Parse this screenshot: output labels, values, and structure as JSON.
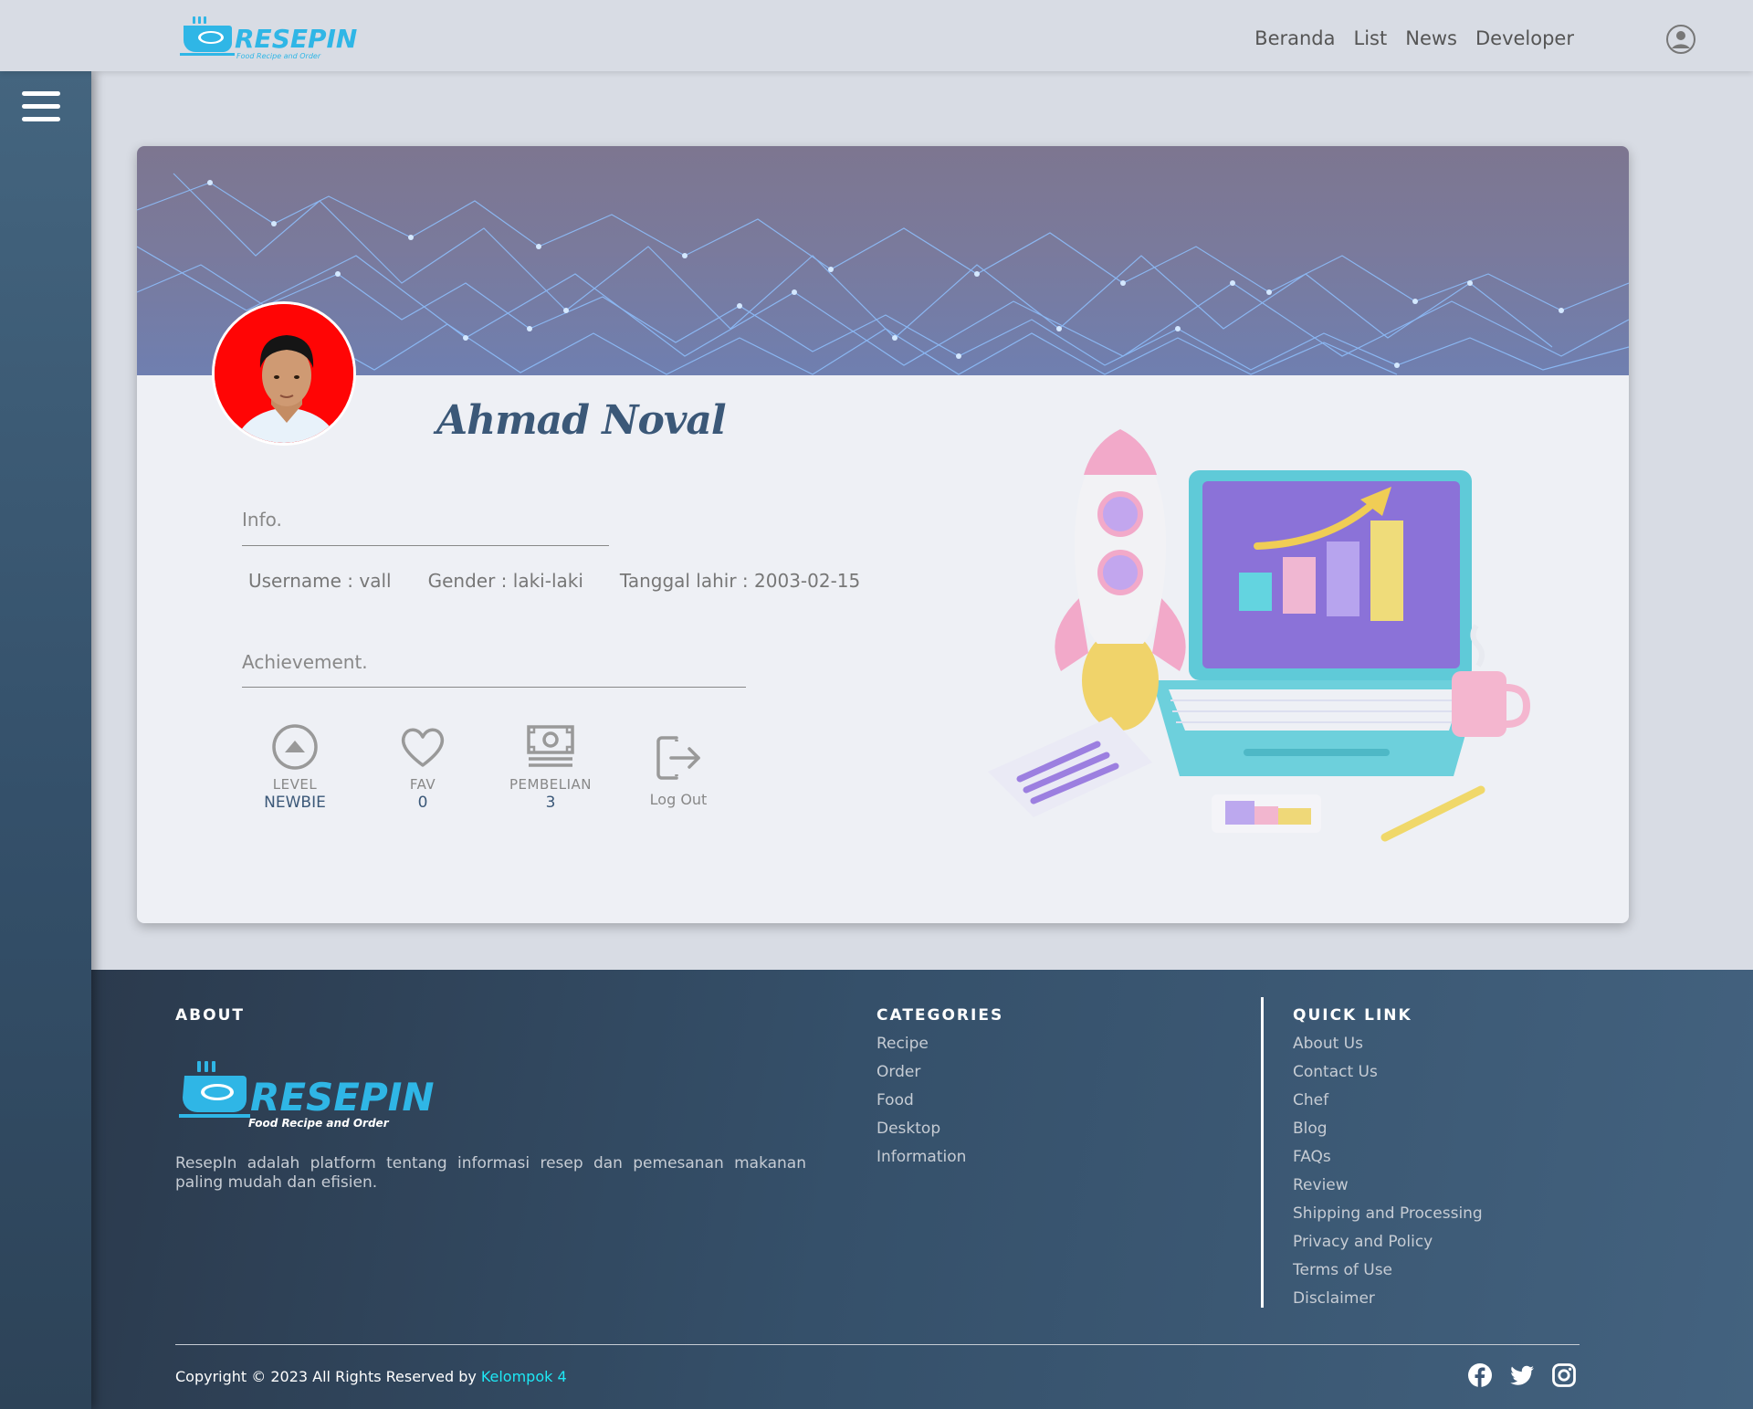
{
  "brand": {
    "name": "RESEPIN",
    "tagline": "Food Recipe and Order"
  },
  "nav": {
    "links": [
      "Beranda",
      "List",
      "News",
      "Developer"
    ]
  },
  "profile": {
    "name": "Ahmad Noval",
    "info_title": "Info.",
    "username_label": "Username : vall",
    "gender_label": "Gender : laki-laki",
    "birth_label": "Tanggal lahir : 2003-02-15",
    "achievement_title": "Achievement.",
    "stats": [
      {
        "label": "LEVEL",
        "value": "NEWBIE",
        "icon": "level-up-icon"
      },
      {
        "label": "FAV",
        "value": "0",
        "icon": "heart-icon"
      },
      {
        "label": "PEMBELIAN",
        "value": "3",
        "icon": "money-icon"
      }
    ],
    "logout_label": "Log Out"
  },
  "footer": {
    "about_title": "ABOUT",
    "about_text": "ResepIn adalah platform tentang informasi resep dan pemesanan makanan paling mudah dan efisien.",
    "categories_title": "CATEGORIES",
    "categories": [
      "Recipe",
      "Order",
      "Food",
      "Desktop",
      "Information"
    ],
    "quick_title": "QUICK LINK",
    "quick_links": [
      "About Us",
      "Contact Us",
      "Chef",
      "Blog",
      "FAQs",
      "Review",
      "Shipping and Processing",
      "Privacy and Policy",
      "Terms of Use",
      "Disclaimer"
    ],
    "copyright": "Copyright © 2023 All Rights Reserved by",
    "copyright_link": "Kelompok 4",
    "socials": [
      "facebook-icon",
      "twitter-icon",
      "instagram-icon"
    ]
  },
  "colors": {
    "accent": "#1ee8f5",
    "brand_blue": "#3b5878",
    "logo_cyan": "#2fb6e6"
  }
}
